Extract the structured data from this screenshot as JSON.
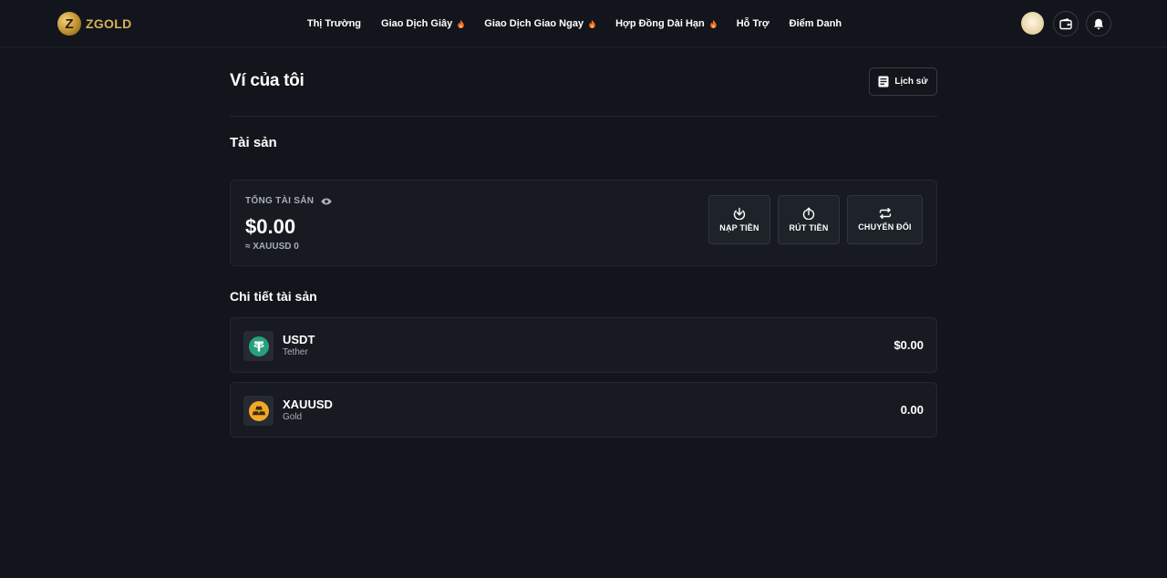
{
  "brand": {
    "name": "ZGOLD",
    "mark": "Z"
  },
  "nav": [
    {
      "label": "Thị Trường",
      "hot": false
    },
    {
      "label": "Giao Dịch Giây",
      "hot": true
    },
    {
      "label": "Giao Dịch Giao Ngay",
      "hot": true
    },
    {
      "label": "Hợp Đồng Dài Hạn",
      "hot": true
    },
    {
      "label": "Hỗ Trợ",
      "hot": false
    },
    {
      "label": "Điểm Danh",
      "hot": false
    }
  ],
  "header_icons": [
    "avatar",
    "wallet-icon",
    "bell-icon"
  ],
  "page": {
    "title": "Ví của tôi",
    "history_label": "Lịch sử"
  },
  "assets": {
    "title": "Tài sản",
    "total_label": "TỔNG TÀI SẢN",
    "total_value": "$0.00",
    "total_sub": "≈ XAUUSD 0",
    "actions": {
      "deposit": "NẠP TIỀN",
      "withdraw": "RÚT TIỀN",
      "convert": "CHUYỂN ĐỔI"
    }
  },
  "details": {
    "title": "Chi tiết tài sản",
    "rows": [
      {
        "symbol": "USDT",
        "name": "Tether",
        "value": "$0.00",
        "icon": "tether-icon",
        "color": "#26a17b"
      },
      {
        "symbol": "XAUUSD",
        "name": "Gold",
        "value": "0.00",
        "icon": "gold-icon",
        "color": "#f0a826"
      }
    ]
  },
  "colors": {
    "background": "#12151b",
    "card": "#171a21",
    "border": "#242831",
    "accent_gold": "#d8b05a",
    "hot": "#f26b2a"
  }
}
